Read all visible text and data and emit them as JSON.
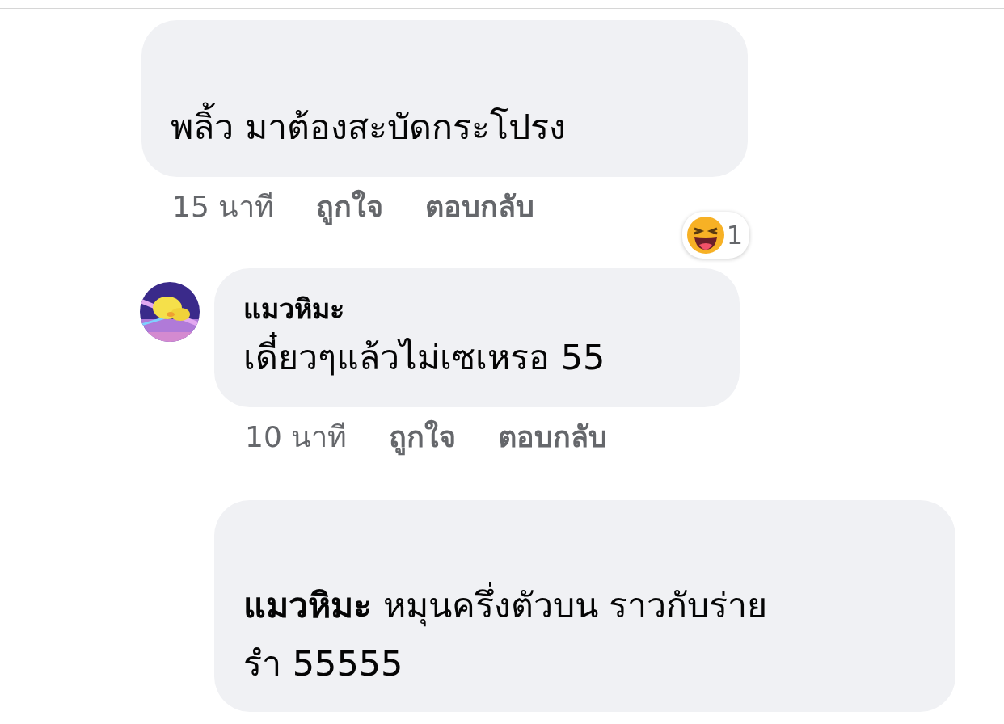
{
  "comments": [
    {
      "text": "พลิ้ว มาต้องสะบัดกระโปรง",
      "reaction": {
        "count": "1"
      },
      "actions": {
        "time": "15 นาที",
        "like": "ถูกใจ",
        "reply": "ตอบกลับ"
      },
      "replies": [
        {
          "name": "แมวหิมะ",
          "text": "เดี๋ยวๆแล้วไม่เซเหรอ 55",
          "actions": {
            "time": "10 นาที",
            "like": "ถูกใจ",
            "reply": "ตอบกลับ"
          }
        },
        {
          "text": "**แมวหิมะ** หมุนครึ่งตัวบน ราวกับร่าย\nรำ 55555"
        }
      ]
    }
  ]
}
